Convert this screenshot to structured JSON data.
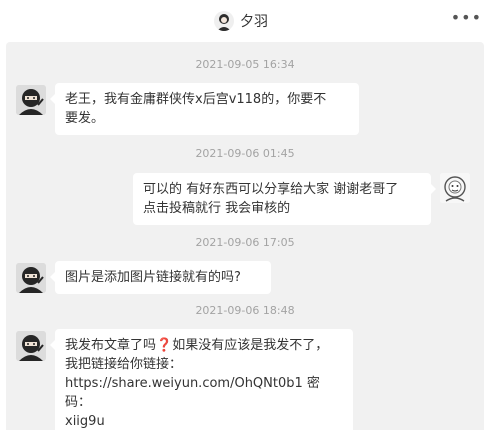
{
  "header": {
    "title": "夕羽",
    "avatar_icon": "user-avatar-icon",
    "more_label": "•••"
  },
  "messages": [
    {
      "timestamp": "2021-09-05 16:34",
      "side": "left",
      "lines": [
        "老王，我有金庸群侠传x后宫v118的，你要不",
        "要发。"
      ]
    },
    {
      "timestamp": "2021-09-06 01:45",
      "side": "right",
      "lines": [
        "可以的 有好东西可以分享给大家 谢谢老哥了",
        "点击投稿就行 我会审核的"
      ]
    },
    {
      "timestamp": "2021-09-06 17:05",
      "side": "left",
      "lines": [
        "图片是添加图片链接就有的吗?"
      ]
    },
    {
      "timestamp": "2021-09-06 18:48",
      "side": "left",
      "line1_pre": "我发布文章了吗",
      "line1_q": "❓",
      "line1_post": "如果没有应该是我发不了，",
      "lines": [
        "我把链接给你链接：",
        "https://share.weiyun.com/OhQNt0b1 密码：",
        "xiig9u"
      ]
    }
  ]
}
